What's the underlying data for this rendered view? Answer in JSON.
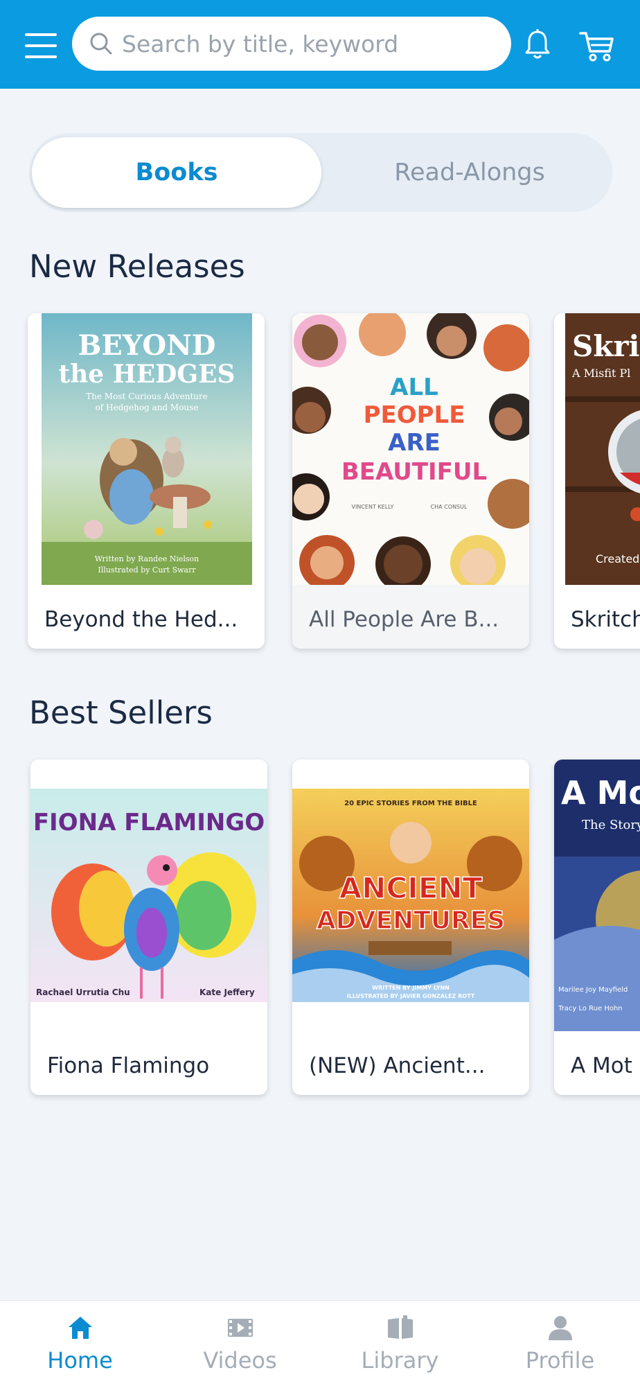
{
  "header": {
    "search_placeholder": "Search by title, keyword",
    "icons": [
      "menu-icon",
      "search-icon",
      "bell-icon",
      "cart-icon"
    ]
  },
  "tabs": [
    {
      "label": "Books",
      "active": true
    },
    {
      "label": "Read-Alongs",
      "active": false
    }
  ],
  "sections": {
    "new_releases": {
      "title": "New Releases",
      "items": [
        {
          "title": "Beyond the Hed..."
        },
        {
          "title": "All People Are B..."
        },
        {
          "title": "Skritch"
        }
      ]
    },
    "best_sellers": {
      "title": "Best Sellers",
      "items": [
        {
          "title": "Fiona Flamingo"
        },
        {
          "title": "(NEW) Ancient..."
        },
        {
          "title": "A Mot"
        }
      ]
    }
  },
  "covers": {
    "beyond": {
      "title_1": "BEYOND",
      "title_2": "the HEDGES",
      "subtitle_1": "The Most Curious Adventure",
      "subtitle_2": "of Hedgehog and Mouse",
      "credit_1": "Written by Randee Nielson",
      "credit_2": "Illustrated by Curt Swarr"
    },
    "all_people": {
      "line_1": "ALL",
      "line_2": "PEOPLE",
      "line_3": "ARE",
      "line_4": "BEAUTIFUL",
      "credit_author": "VINCENT KELLY",
      "credit_illustrator": "CHA CONSUL"
    },
    "skritch": {
      "title": "Skrit",
      "subtitle": "A Misfit Pl",
      "credit": "Created"
    },
    "fiona": {
      "title": "FIONA FLAMINGO",
      "credit_author": "Rachael Urrutia Chu",
      "credit_illustrator": "Kate Jeffery"
    },
    "ancient": {
      "tagline": "20 EPIC STORIES FROM THE BIBLE",
      "title_1": "ANCIENT",
      "title_2": "ADVENTURES",
      "credit_1": "WRITTEN BY JIMMY LYNN",
      "credit_2": "ILLUSTRATED BY JAVIER GONZALEZ ROTT"
    },
    "amot": {
      "title": "A Mot",
      "subtitle": "The Story",
      "credit_1": "Marilee Joy Mayfield",
      "credit_2": "Tracy Lo Rue Hohn"
    }
  },
  "bottom_nav": [
    {
      "label": "Home",
      "icon": "home-icon",
      "active": true
    },
    {
      "label": "Videos",
      "icon": "video-icon",
      "active": false
    },
    {
      "label": "Library",
      "icon": "book-icon",
      "active": false
    },
    {
      "label": "Profile",
      "icon": "person-icon",
      "active": false
    }
  ],
  "colors": {
    "header_bg": "#0b9be0",
    "accent": "#0b8bd0",
    "page_bg": "#f1f4f9"
  }
}
